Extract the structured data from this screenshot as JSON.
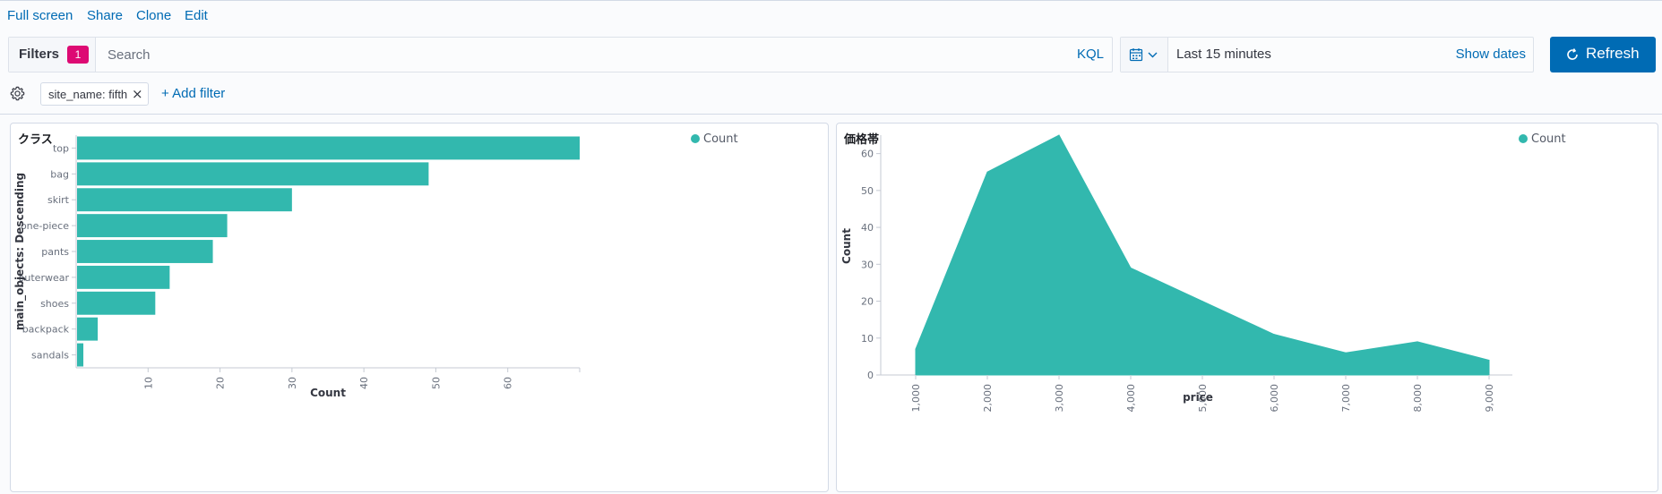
{
  "nav": {
    "full_screen": "Full screen",
    "share": "Share",
    "clone": "Clone",
    "edit": "Edit"
  },
  "query": {
    "filters_label": "Filters",
    "filters_count": "1",
    "search_placeholder": "Search",
    "language": "KQL"
  },
  "time": {
    "range": "Last 15 minutes",
    "show_dates": "Show dates",
    "refresh": "Refresh"
  },
  "filter_bar": {
    "pills": [
      {
        "label": "site_name: fifth"
      }
    ],
    "add_filter": "+ Add filter"
  },
  "colors": {
    "accent": "#006bb4",
    "badge": "#dd0a73",
    "series": "#32b8ae"
  },
  "icons": [
    "calendar-icon",
    "chevron-down-icon",
    "refresh-icon",
    "gear-icon",
    "close-icon"
  ],
  "panels": [
    {
      "title": "クラス"
    },
    {
      "title": "価格帯"
    }
  ],
  "chart_data": [
    {
      "type": "bar",
      "orientation": "horizontal",
      "title": "クラス",
      "categories": [
        "top",
        "bag",
        "skirt",
        "one-piece",
        "pants",
        "outerwear",
        "shoes",
        "backpack",
        "sandals"
      ],
      "series": [
        {
          "name": "Count",
          "values": [
            70,
            49,
            30,
            21,
            19,
            13,
            11,
            3,
            1
          ]
        }
      ],
      "xlabel": "Count",
      "ylabel": "main_objects: Descending",
      "xticks": [
        10,
        20,
        30,
        40,
        50,
        60
      ],
      "xlim": [
        0,
        70
      ],
      "legend": "top-right"
    },
    {
      "type": "area",
      "title": "価格帯",
      "x": [
        "1,000",
        "2,000",
        "3,000",
        "4,000",
        "5,000",
        "6,000",
        "7,000",
        "8,000",
        "9,000"
      ],
      "series": [
        {
          "name": "Count",
          "values": [
            7,
            55,
            65,
            29,
            20,
            11,
            6,
            9,
            4
          ]
        }
      ],
      "xlabel": "price",
      "ylabel": "Count",
      "yticks": [
        0,
        10,
        20,
        30,
        40,
        50,
        60
      ],
      "ylim": [
        0,
        65
      ],
      "legend": "top-right"
    }
  ]
}
